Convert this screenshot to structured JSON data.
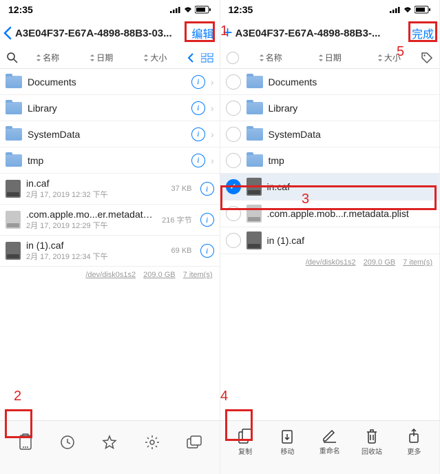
{
  "status": {
    "time": "12:35"
  },
  "left": {
    "nav": {
      "title": "A3E04F37-E67A-4898-88B3-03...",
      "edit": "编辑"
    },
    "sort": {
      "name": "名称",
      "date": "日期",
      "size": "大小"
    },
    "items": [
      {
        "type": "folder",
        "name": "Documents"
      },
      {
        "type": "folder",
        "name": "Library"
      },
      {
        "type": "folder",
        "name": "SystemData"
      },
      {
        "type": "folder",
        "name": "tmp"
      },
      {
        "type": "exec",
        "name": "in.caf",
        "sub": "2月 17, 2019 12:32 下午",
        "size": "37 KB"
      },
      {
        "type": "plist",
        "name": ".com.apple.mo...er.metadata.plist",
        "sub": "2月 17, 2019 12:29 下午",
        "size": "216 字节"
      },
      {
        "type": "exec",
        "name": "in (1).caf",
        "sub": "2月 17, 2019 12:34 下午",
        "size": "69 KB"
      }
    ],
    "summary": {
      "disk": "/dev/disk0s1s2",
      "free": "209.0 GB",
      "count": "7 item(s)"
    }
  },
  "right": {
    "nav": {
      "title": "A3E04F37-E67A-4898-88B3-...",
      "done": "完成"
    },
    "sort": {
      "name": "名称",
      "date": "日期",
      "size": "大小"
    },
    "items": [
      {
        "type": "folder",
        "name": "Documents",
        "selected": false
      },
      {
        "type": "folder",
        "name": "Library",
        "selected": false
      },
      {
        "type": "folder",
        "name": "SystemData",
        "selected": false
      },
      {
        "type": "folder",
        "name": "tmp",
        "selected": false
      },
      {
        "type": "exec",
        "name": "in.caf",
        "selected": true
      },
      {
        "type": "plist",
        "name": ".com.apple.mob...r.metadata.plist",
        "selected": false
      },
      {
        "type": "exec",
        "name": "in (1).caf",
        "selected": false
      }
    ],
    "summary": {
      "disk": "/dev/disk0s1s2",
      "free": "209.0 GB",
      "count": "7 item(s)"
    },
    "toolbar": {
      "copy": "复制",
      "move": "移动",
      "rename": "重命名",
      "trash": "回收站",
      "more": "更多"
    }
  },
  "annotations": [
    "1",
    "2",
    "3",
    "4",
    "5"
  ]
}
